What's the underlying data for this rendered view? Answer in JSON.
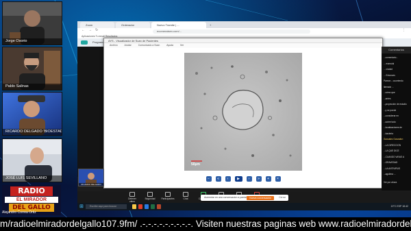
{
  "participants": [
    {
      "name": "Jorge Osorio",
      "skin": "#9a7660",
      "bg": "#3b3b3b"
    },
    {
      "name": "Pablo Salinas",
      "skin": "#c69c80",
      "bg": "#4a3a30"
    },
    {
      "name": "RICARDO DELGADO 'BIOESTADI...",
      "skin": "#cc9b7a",
      "bg": "#2a4fb0"
    },
    {
      "name": "JOSÉ LUIS SEVILLANO",
      "skin": "#d5a88c",
      "bg": "#cfd4dc"
    }
  ],
  "radio_logo": {
    "line1": "RADIO",
    "line2": "EL MIRADOR",
    "line3": "DEL GALLO"
  },
  "under_logo_name": "Alejandro Correa Ortiz",
  "browser": {
    "tabs": [
      "Zoom",
      "Ordenador",
      "Nuevo Tramite | ...",
      "+"
    ],
    "address": "ecomeraisen.com/...",
    "bookmarks": "Aplicaciones   Tu email   Resultados"
  },
  "app": {
    "title": "Programa"
  },
  "viewer": {
    "title": "AYS - Visualizador de Scan de Pacientes",
    "menu": [
      "Archivo",
      "Anotar",
      "Comunicado a Scan",
      "Ayuda",
      "Ver"
    ],
    "scale_label": "50µm"
  },
  "right_panel": {
    "header": "Comentarios",
    "lines": [
      {
        "t": "...comentario...",
        "accent": false
      },
      {
        "t": "... esencial",
        "accent": false
      },
      {
        "t": "... ciudad",
        "accent": false
      },
      {
        "t": "... Entonces",
        "accent": false
      },
      {
        "t": "Parece... ocurriendo",
        "accent": false
      },
      {
        "t": "llamado ...",
        "accent": false
      },
      {
        "t": "...cómo que",
        "accent": false
      },
      {
        "t": "...antes",
        "accent": false
      },
      {
        "t": "...proyección de estudio",
        "accent": false
      },
      {
        "t": "...y se puede",
        "accent": false
      },
      {
        "t": "...considerar en",
        "accent": false
      },
      {
        "t": "...sobre todo",
        "accent": false
      },
      {
        "t": "...localizaciones de",
        "accent": false
      },
      {
        "t": "...bacteria",
        "accent": false
      },
      {
        "t": "Gonzalez Gonzalez:",
        "accent": true
      },
      {
        "t": "...LA DIRECCION",
        "accent": false
      },
      {
        "t": "...LA QUE DICE",
        "accent": false
      },
      {
        "t": "...CUANDO VAYAS A",
        "accent": false
      },
      {
        "t": "...GRAVEDAD",
        "accent": false
      },
      {
        "t": "...LA ANTIVIRUS",
        "accent": false
      },
      {
        "t": "...aguilera ...",
        "accent": false
      }
    ],
    "bottom": "Ver por ahora"
  },
  "shared_thumb": "RICARDO DELGADO",
  "toast": {
    "text": "Aumentar en ana conversacion a pantallas...",
    "button": "Nueva conversación",
    "close": "Cerrar"
  },
  "zoom_controls": [
    "Detener video",
    "Seguridad",
    "Participantes",
    "Chat",
    "Compartir",
    "Grabar",
    "Reacciones",
    "Salir"
  ],
  "taskbar": {
    "search": "Escribe aquí para buscar",
    "tray": "19°C  ESP  18:42"
  },
  "ticker": "m/radioelmiradordelgallo107.9fm/ .-.-.-.-.-.-.-.-.-. Visiten nuestras paginas web www.radioelmiradordelgallo"
}
